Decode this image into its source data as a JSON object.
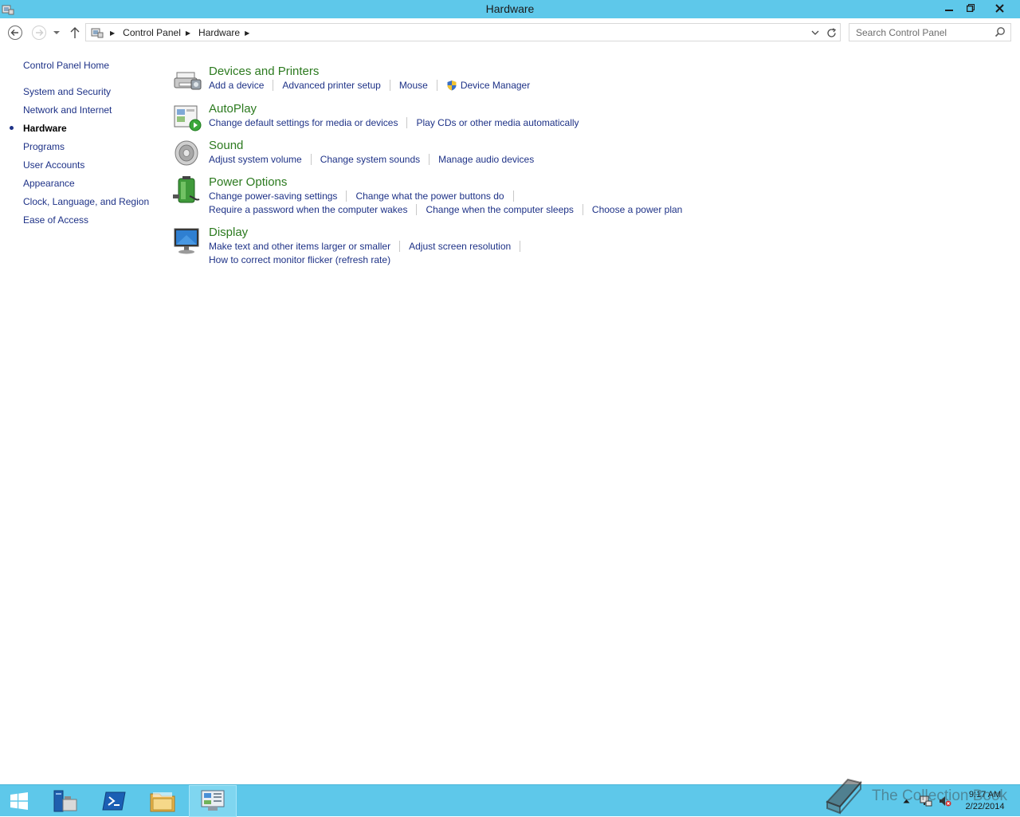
{
  "window": {
    "title": "Hardware"
  },
  "address": {
    "crumbs": [
      "Control Panel",
      "Hardware"
    ]
  },
  "search": {
    "placeholder": "Search Control Panel"
  },
  "leftnav": {
    "home": "Control Panel Home",
    "items": [
      {
        "label": "System and Security",
        "current": false
      },
      {
        "label": "Network and Internet",
        "current": false
      },
      {
        "label": "Hardware",
        "current": true
      },
      {
        "label": "Programs",
        "current": false
      },
      {
        "label": "User Accounts",
        "current": false
      },
      {
        "label": "Appearance",
        "current": false
      },
      {
        "label": "Clock, Language, and Region",
        "current": false
      },
      {
        "label": "Ease of Access",
        "current": false
      }
    ]
  },
  "categories": [
    {
      "title": "Devices and Printers",
      "icon": "printer-icon",
      "rows": [
        [
          "Add a device",
          "Advanced printer setup",
          "Mouse",
          "Device Manager"
        ]
      ]
    },
    {
      "title": "AutoPlay",
      "icon": "autoplay-icon",
      "rows": [
        [
          "Change default settings for media or devices",
          "Play CDs or other media automatically"
        ]
      ]
    },
    {
      "title": "Sound",
      "icon": "speaker-icon",
      "rows": [
        [
          "Adjust system volume",
          "Change system sounds",
          "Manage audio devices"
        ]
      ]
    },
    {
      "title": "Power Options",
      "icon": "battery-icon",
      "rows": [
        [
          "Change power-saving settings",
          "Change what the power buttons do"
        ],
        [
          "Require a password when the computer wakes",
          "Change when the computer sleeps",
          "Choose a power plan"
        ]
      ]
    },
    {
      "title": "Display",
      "icon": "monitor-icon",
      "rows": [
        [
          "Make text and other items larger or smaller",
          "Adjust screen resolution"
        ],
        [
          "How to correct monitor flicker (refresh rate)"
        ]
      ]
    }
  ],
  "taskbar": {
    "clock_time": "9:17 AM",
    "clock_date": "2/22/2014",
    "watermark": "The Collection Book"
  },
  "colors": {
    "titlebar": "#5ec8ea",
    "link": "#1e3287",
    "category_title": "#2c7a1f"
  }
}
